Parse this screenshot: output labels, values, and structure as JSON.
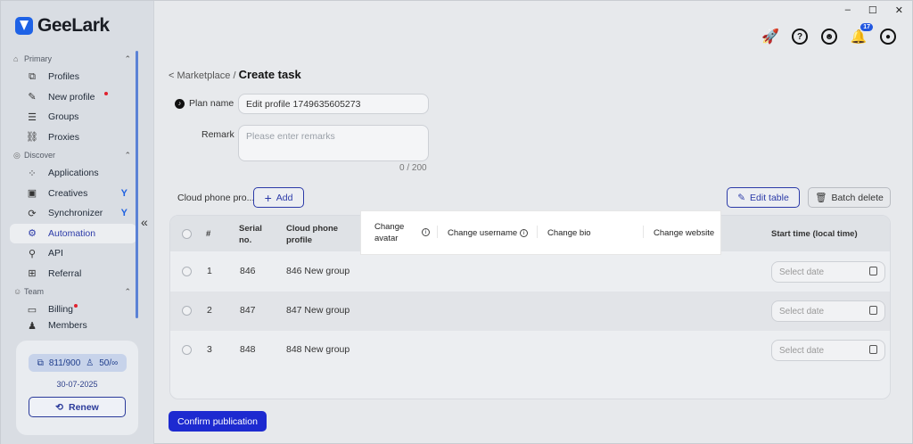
{
  "app": {
    "name": "GeeLark"
  },
  "window": {
    "minimize": "–",
    "maximize": "☐",
    "close": "✕"
  },
  "topbar": {
    "notifications_count": "17"
  },
  "sidebar": {
    "sections": [
      {
        "label": "Primary",
        "items": [
          {
            "label": "Profiles"
          },
          {
            "label": "New profile"
          },
          {
            "label": "Groups"
          },
          {
            "label": "Proxies"
          }
        ]
      },
      {
        "label": "Discover",
        "items": [
          {
            "label": "Applications"
          },
          {
            "label": "Creatives"
          },
          {
            "label": "Synchronizer"
          },
          {
            "label": "Automation"
          },
          {
            "label": "API"
          },
          {
            "label": "Referral"
          }
        ]
      },
      {
        "label": "Team",
        "items": [
          {
            "label": "Billing"
          },
          {
            "label": "Members"
          }
        ]
      }
    ],
    "quota": {
      "profiles": "811/900",
      "members": "50/∞",
      "date": "30-07-2025",
      "renew_label": "Renew"
    }
  },
  "breadcrumb": {
    "parent": "< Marketplace /",
    "current": "Create task"
  },
  "form": {
    "plan_name_label": "Plan name",
    "plan_name_value": "Edit profile 1749635605273",
    "remark_label": "Remark",
    "remark_placeholder": "Please enter remarks",
    "remark_counter": "0 / 200"
  },
  "phones": {
    "section_title": "Cloud phone pro...",
    "add_label": "Add",
    "edit_table_label": "Edit table",
    "batch_delete_label": "Batch delete",
    "columns": {
      "index": "#",
      "serial": "Serial no.",
      "cloud_phone_profile": "Cloud phone profile",
      "change_avatar": "Change avatar",
      "change_username": "Change username",
      "change_bio": "Change bio",
      "change_website": "Change website",
      "start_time": "Start time (local time)"
    },
    "rows": [
      {
        "index": "1",
        "serial": "846",
        "profile": "846 New group",
        "date_placeholder": "Select date"
      },
      {
        "index": "2",
        "serial": "847",
        "profile": "847 New group",
        "date_placeholder": "Select date"
      },
      {
        "index": "3",
        "serial": "848",
        "profile": "848 New group",
        "date_placeholder": "Select date"
      }
    ]
  },
  "footer": {
    "confirm_label": "Confirm publication"
  },
  "colors": {
    "primary": "#1d2ad0",
    "accent_red": "#e0212e",
    "link_blue": "#2b3aa8"
  }
}
